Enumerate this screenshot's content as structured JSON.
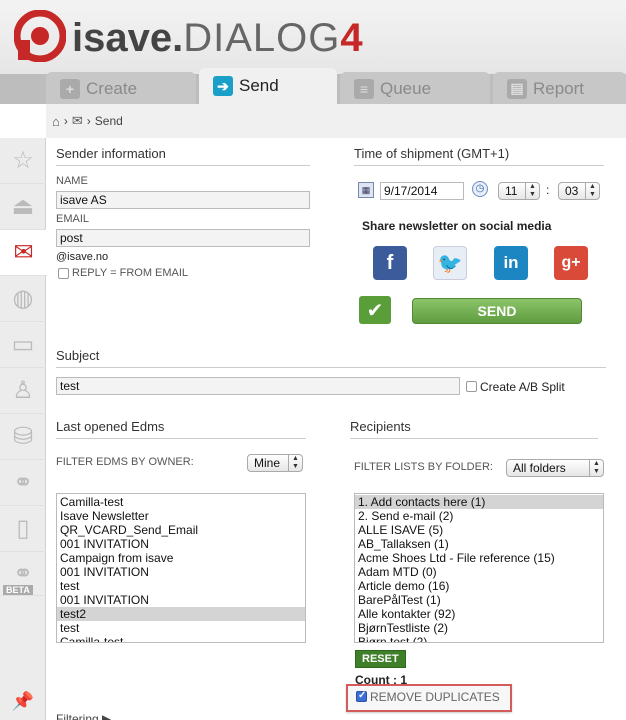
{
  "app": {
    "brand": "isave",
    "dot": ".",
    "dialog": "DIALOG",
    "version": "4"
  },
  "tabs": [
    {
      "label": "Create",
      "icon": "plus-icon"
    },
    {
      "label": "Send",
      "icon": "arrow-right-icon",
      "active": true
    },
    {
      "label": "Queue",
      "icon": "queue-icon"
    },
    {
      "label": "Report",
      "icon": "report-icon"
    }
  ],
  "breadcrumb": {
    "sep": "›",
    "current": "Send"
  },
  "sidebar": {
    "beta": "BETA",
    "items": [
      "star-icon",
      "inbox-tray-icon",
      "mail-icon",
      "globe-icon",
      "folder-icon",
      "user-icon",
      "database-icon",
      "share-network-icon",
      "phone-icon",
      "beta-share-network-icon",
      "pin-icon"
    ]
  },
  "sender": {
    "title": "Sender information",
    "name_label": "NAME",
    "name_value": "isave AS",
    "email_label": "EMAIL",
    "email_value": "post",
    "email_domain": "@isave.no",
    "reply_label": "REPLY = FROM EMAIL"
  },
  "shipment": {
    "title": "Time of shipment (GMT+1)",
    "date": "9/17/2014",
    "hour": "11",
    "colon": ":",
    "minute": "03",
    "social_title": "Share newsletter on social media",
    "send_label": "SEND"
  },
  "subject": {
    "title": "Subject",
    "value": "test",
    "ab_label": "Create A/B Split"
  },
  "edms": {
    "title": "Last opened Edms",
    "filter_label": "FILTER EDMS BY OWNER:",
    "filter_value": "Mine",
    "items": [
      "Camilla-test",
      "Isave Newsletter",
      "QR_VCARD_Send_Email",
      "001 INVITATION",
      "Campaign from isave",
      "001 INVITATION",
      "test",
      "001 INVITATION",
      "test2",
      "test",
      "Camilla-test"
    ],
    "selected_index": 8
  },
  "recipients": {
    "title": "Recipients",
    "filter_label": "FILTER LISTS BY FOLDER:",
    "filter_value": "All folders",
    "items": [
      "1. Add contacts here (1)",
      "2. Send e-mail (2)",
      "ALLE ISAVE (5)",
      "AB_Tallaksen (1)",
      "Acme Shoes Ltd - File reference (15)",
      "Adam MTD (0)",
      "Article demo (16)",
      "BarePålTest (1)",
      "Alle kontakter (92)",
      "BjørnTestliste (2)",
      "Bjørn test (2)"
    ],
    "selected_index": 0,
    "reset_label": "RESET",
    "count_label": "Count : 1",
    "remove_dup_label": "REMOVE DUPLICATES"
  },
  "footer": {
    "filtering_label": "Filtering ▶"
  },
  "colors": {
    "brand_red": "#c62828",
    "send_green": "#5f9c3f",
    "tab_active_icon": "#1aa0c8"
  }
}
